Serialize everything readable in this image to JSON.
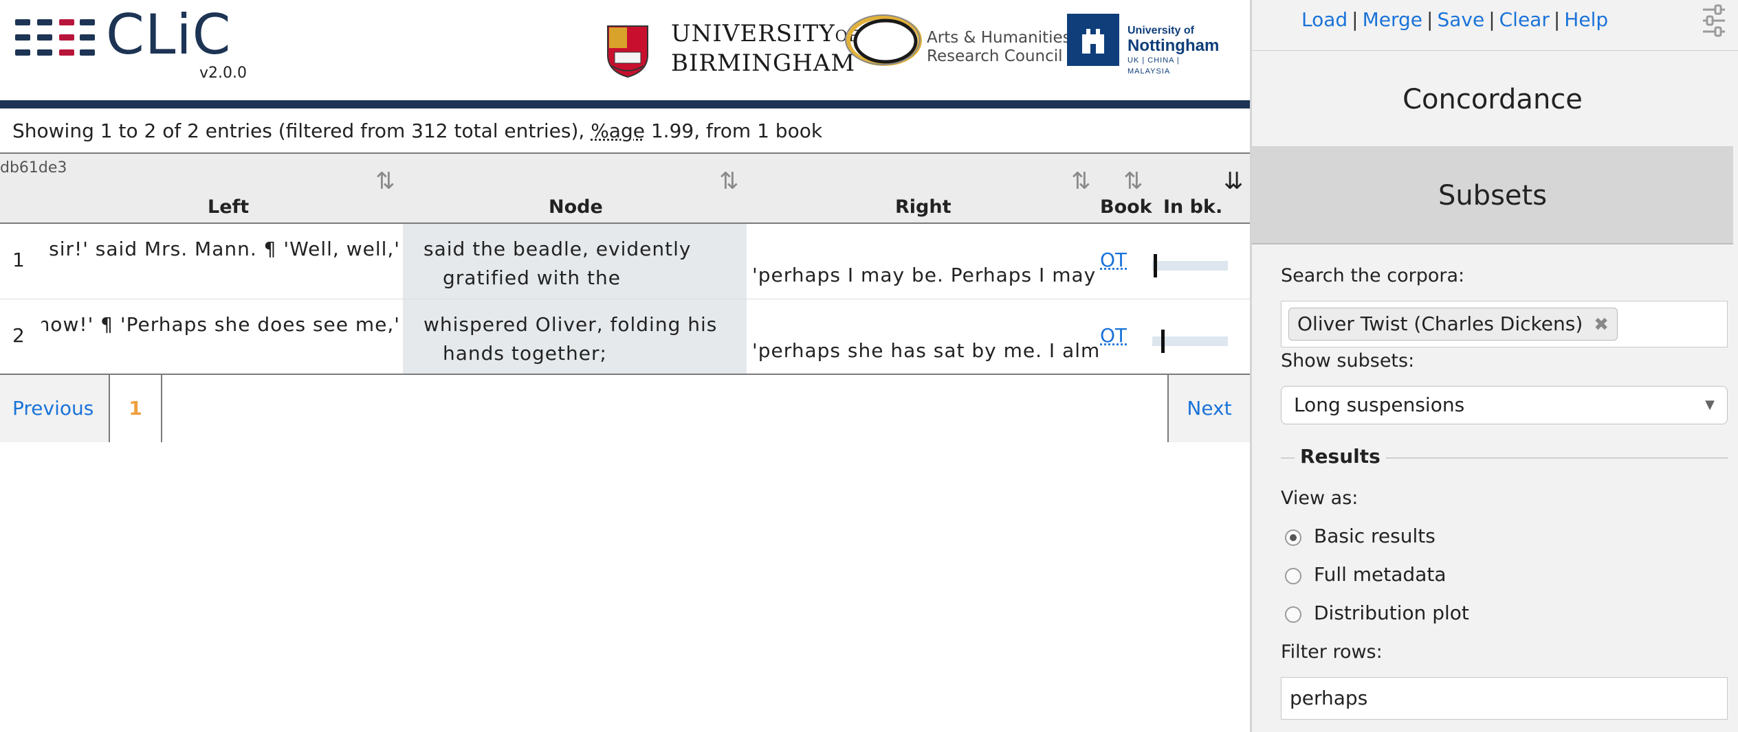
{
  "header": {
    "app_name": "CLiC",
    "version": "v2.0.0",
    "partners": {
      "uob_line1": "UNIVERSITY",
      "uob_of": "OF",
      "uob_line2": "BIRMINGHAM",
      "ahrc_line1": "Arts & Humanities",
      "ahrc_line2": "Research Council",
      "uon_line1": "University of",
      "uon_line2": "Nottingham",
      "uon_line3": "UK | CHINA | MALAYSIA"
    },
    "colors": {
      "brand": "#1d3454",
      "rule": "#1d3454"
    }
  },
  "results_info": {
    "prefix": "Showing 1 to 2 of 2 entries (filtered from 312 total entries), ",
    "percentage_label": "%age",
    "suffix": " 1.99, from 1 book"
  },
  "table": {
    "tag_id": "db61de3",
    "columns": {
      "left": "Left",
      "node": "Node",
      "right": "Right",
      "book": "Book",
      "in_book": "In bk."
    },
    "rows": [
      {
        "num": "1",
        "left": "sir, sir!' said Mrs. Mann. ¶ 'Well, well,'",
        "node_line1": "said the beadle, evidently",
        "node_line2": "gratified with the compliment;",
        "right": "'perhaps I may be. Perhaps I may be, Mrs. Mann.'",
        "book": "OT",
        "in_book_position": 0.02
      },
      {
        "num": "2",
        "left": "now!' ¶ 'Perhaps she does see me,'",
        "node_line1": "whispered Oliver, folding his",
        "node_line2": "hands together;",
        "right": "'perhaps she has sat by me. I almost feel as if she had.'",
        "book": "OT",
        "in_book_position": 0.12
      }
    ]
  },
  "pager": {
    "previous": "Previous",
    "current": "1",
    "next": "Next"
  },
  "panel": {
    "menu": {
      "load": "Load",
      "merge": "Merge",
      "save": "Save",
      "clear": "Clear",
      "help": "Help"
    },
    "tabs": {
      "concordance": "Concordance",
      "subsets": "Subsets"
    },
    "search_label": "Search the corpora:",
    "corpus_chip": "Oliver Twist (Charles Dickens)",
    "subsets_label": "Show subsets:",
    "subsets_value": "Long suspensions",
    "results_legend": "Results",
    "view_as_label": "View as:",
    "view_options": [
      "Basic results",
      "Full metadata",
      "Distribution plot"
    ],
    "view_selected": "Basic results",
    "filter_label": "Filter rows:",
    "filter_value": "perhaps",
    "colors": {
      "link": "#1a73d9",
      "active_page": "#f0a040",
      "node_bg": "#e5e9ec"
    }
  }
}
